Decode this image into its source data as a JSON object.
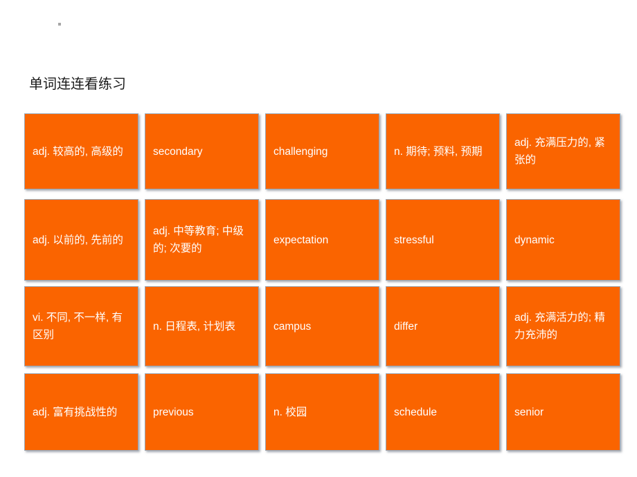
{
  "slide": {
    "title": "单词连连看练习",
    "background_color": "#ffffff",
    "bullet_marker_color": "#a6a6a6"
  },
  "card_style": {
    "fill_color": "#fa6400",
    "text_color": "#ffffff",
    "border_color": "#9aa7b5"
  },
  "grid": {
    "columns": 5,
    "rows": 4,
    "cards": [
      [
        {
          "text": "adj. 较高的, 高级的"
        },
        {
          "text": "secondary"
        },
        {
          "text": "challenging"
        },
        {
          "text": "n. 期待; 预料, 预期"
        },
        {
          "text": "adj. 充满压力的, 紧张的"
        }
      ],
      [
        {
          "text": "adj. 以前的, 先前的"
        },
        {
          "text": "adj. 中等教育; 中级的; 次要的"
        },
        {
          "text": "expectation"
        },
        {
          "text": "stressful"
        },
        {
          "text": "dynamic"
        }
      ],
      [
        {
          "text": "vi. 不同, 不一样, 有区别"
        },
        {
          "text": "n. 日程表, 计划表"
        },
        {
          "text": "campus"
        },
        {
          "text": "differ"
        },
        {
          "text": "adj. 充满活力的; 精力充沛的"
        }
      ],
      [
        {
          "text": "adj. 富有挑战性的"
        },
        {
          "text": "previous"
        },
        {
          "text": "n. 校园"
        },
        {
          "text": "schedule"
        },
        {
          "text": "senior"
        }
      ]
    ]
  }
}
